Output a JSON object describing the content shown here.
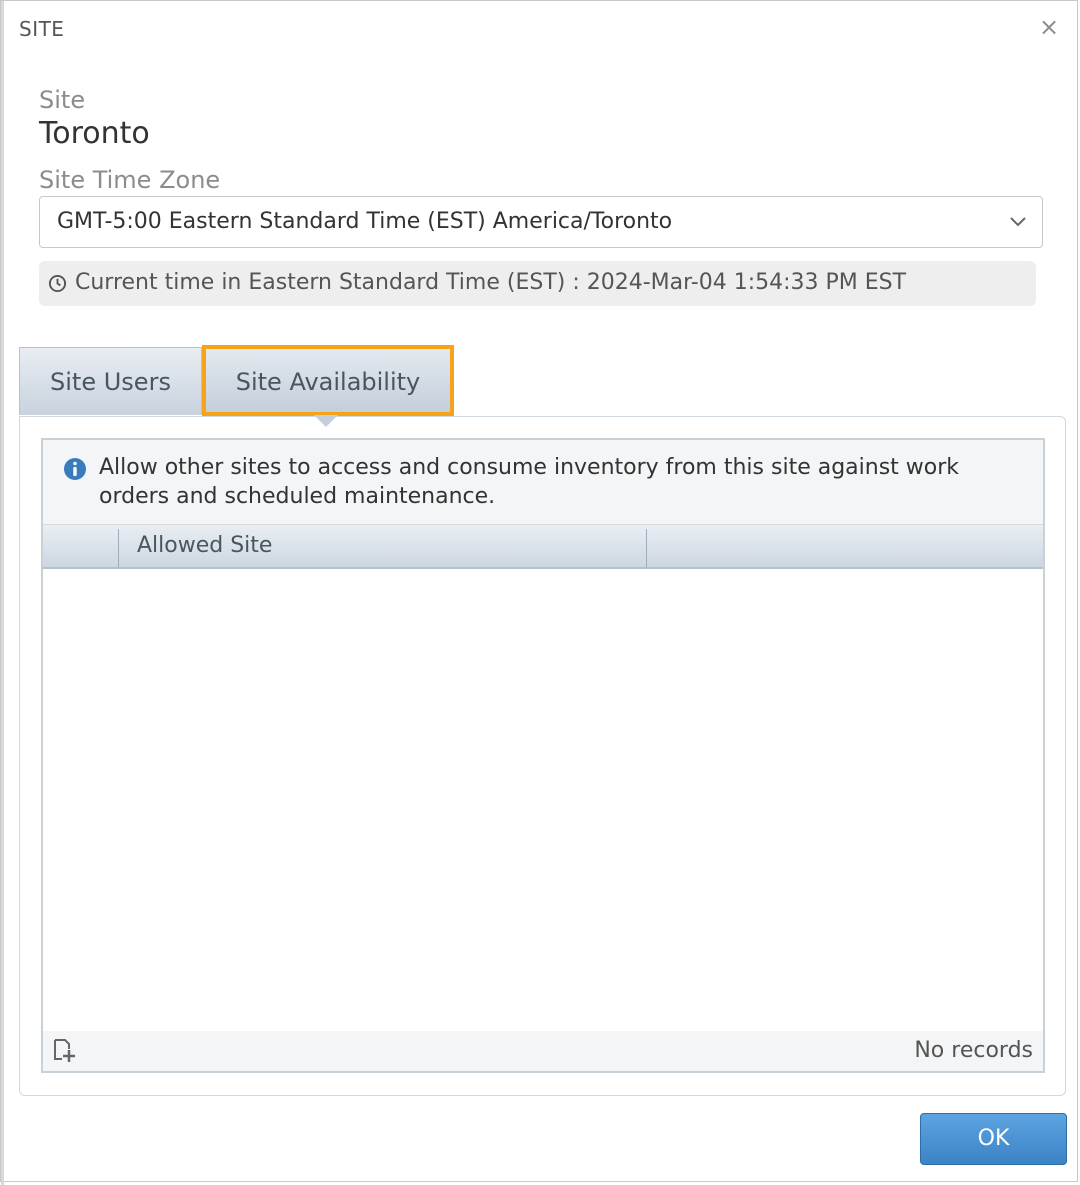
{
  "dialog": {
    "title": "SITE",
    "close_glyph": "×"
  },
  "site": {
    "label": "Site",
    "name": "Toronto"
  },
  "timezone": {
    "label": "Site Time Zone",
    "selected": "GMT-5:00 Eastern Standard Time (EST) America/Toronto",
    "current_time_text": "Current time in Eastern Standard Time (EST) : 2024-Mar-04 1:54:33 PM EST"
  },
  "tabs": [
    {
      "label": "Site Users",
      "active": false
    },
    {
      "label": "Site Availability",
      "active": true
    }
  ],
  "availability": {
    "info_text": "Allow other sites to access and consume inventory from this site against work orders and scheduled maintenance.",
    "columns": [
      "",
      "Allowed Site",
      ""
    ],
    "rows": [],
    "empty_text": "No records"
  },
  "footer": {
    "ok_label": "OK"
  },
  "colors": {
    "accent_highlight": "#f5a31a",
    "button_blue": "#3c83c6",
    "info_blue": "#3a7bbf"
  },
  "icons": {
    "close": "close-icon",
    "chevron": "chevron-down-icon",
    "clock": "clock-icon",
    "info": "info-icon",
    "add": "add-record-icon"
  }
}
